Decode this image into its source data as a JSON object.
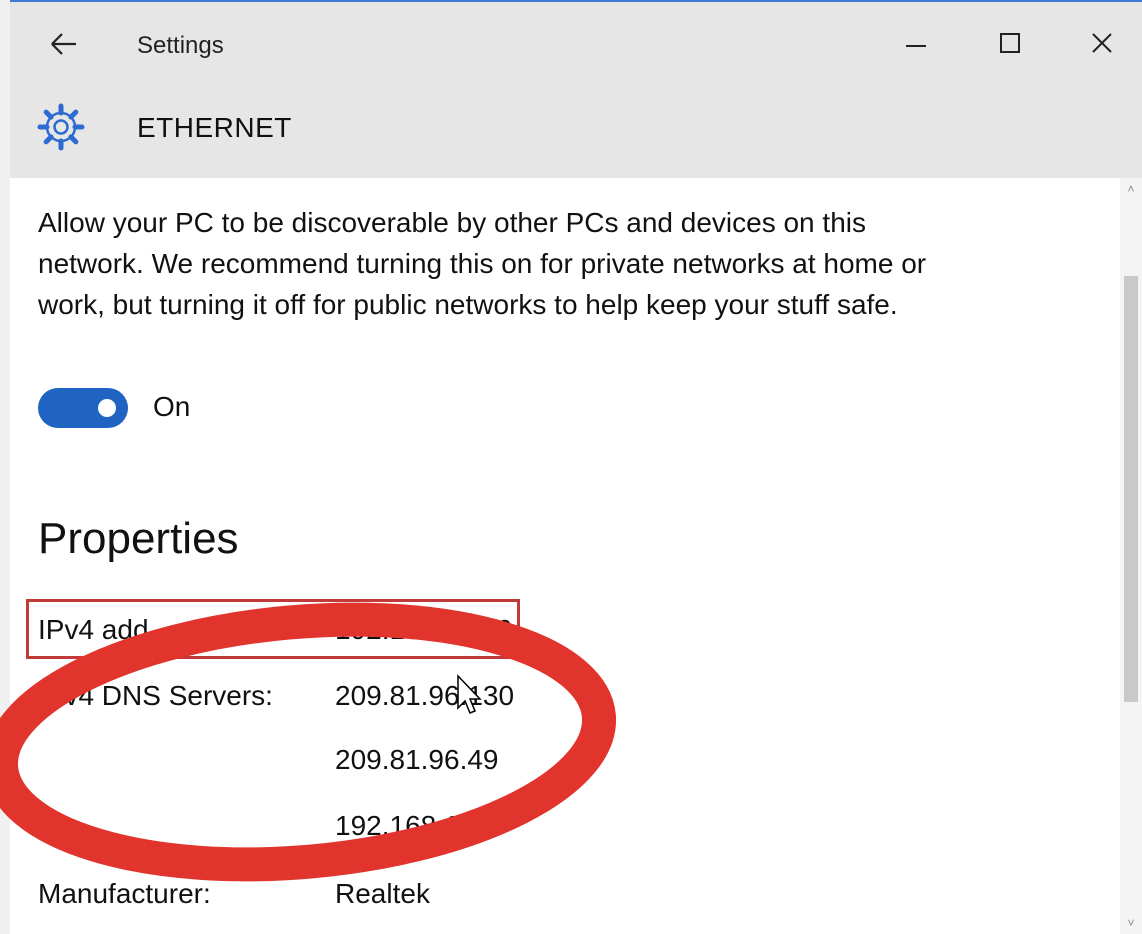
{
  "window": {
    "app_title": "Settings",
    "page_title": "ETHERNET",
    "controls": {
      "back": "back-arrow-icon",
      "minimize": "minimize-icon",
      "maximize": "maximize-icon",
      "close": "close-icon"
    }
  },
  "network": {
    "description": "Allow your PC to be discoverable by other PCs and devices on this network. We recommend turning this on for private networks at home or work, but turning it off for public networks to help keep your stuff safe.",
    "toggle_state": "On",
    "toggle_on": true
  },
  "properties": {
    "heading": "Properties",
    "rows": [
      {
        "key": "IPv4 add",
        "value": "192.168.1.116"
      },
      {
        "key": "IPv4 DNS Servers:",
        "value": "209.81.96.130"
      },
      {
        "key": "",
        "value": "209.81.96.49"
      },
      {
        "key": "",
        "value": "192.168.1.1"
      },
      {
        "key": "Manufacturer:",
        "value": "Realtek"
      }
    ]
  },
  "colors": {
    "accent": "#1f64c3",
    "annotation_red": "#e0342c",
    "titlebar": "#e6e6e6"
  }
}
